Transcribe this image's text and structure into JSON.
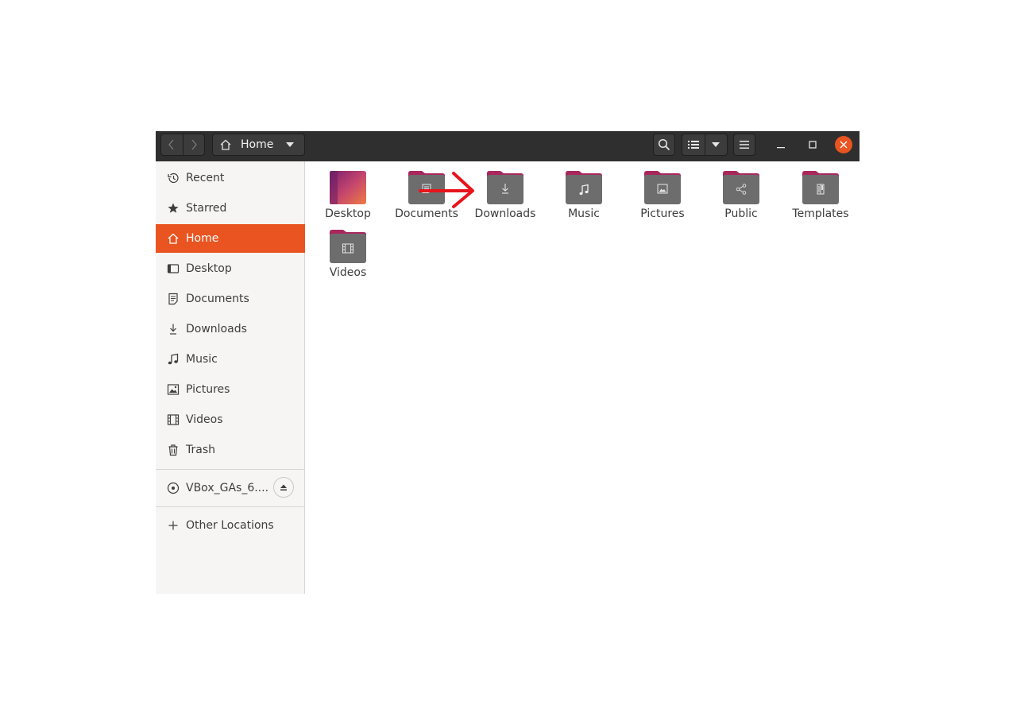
{
  "window": {
    "path": {
      "label": "Home"
    },
    "headerbar": {
      "back_icon": "chevron-left-icon",
      "forward_icon": "chevron-right-icon",
      "search_icon": "search-icon",
      "view_icon": "list-view-icon",
      "menu_icon": "hamburger-menu-icon"
    }
  },
  "sidebar": {
    "items": [
      {
        "label": "Recent",
        "icon": "recent-icon"
      },
      {
        "label": "Starred",
        "icon": "star-icon"
      },
      {
        "label": "Home",
        "icon": "home-icon",
        "active": true
      },
      {
        "label": "Desktop",
        "icon": "desktop-icon"
      },
      {
        "label": "Documents",
        "icon": "documents-icon"
      },
      {
        "label": "Downloads",
        "icon": "download-icon"
      },
      {
        "label": "Music",
        "icon": "music-icon"
      },
      {
        "label": "Pictures",
        "icon": "pictures-icon"
      },
      {
        "label": "Videos",
        "icon": "videos-icon"
      },
      {
        "label": "Trash",
        "icon": "trash-icon"
      }
    ],
    "device": {
      "label": "VBox_GAs_6....",
      "icon": "disc-icon",
      "eject_icon": "eject-icon"
    },
    "other_locations": {
      "label": "Other Locations",
      "icon": "plus-icon"
    }
  },
  "files": [
    {
      "name": "Desktop",
      "icon": "desktop-folder-icon"
    },
    {
      "name": "Documents",
      "icon": "documents-folder-icon"
    },
    {
      "name": "Downloads",
      "icon": "downloads-folder-icon"
    },
    {
      "name": "Music",
      "icon": "music-folder-icon"
    },
    {
      "name": "Pictures",
      "icon": "pictures-folder-icon"
    },
    {
      "name": "Public",
      "icon": "public-folder-icon"
    },
    {
      "name": "Templates",
      "icon": "templates-folder-icon"
    },
    {
      "name": "Videos",
      "icon": "videos-folder-icon"
    }
  ],
  "colors": {
    "accent": "#e95420",
    "headerbar": "#2f2f2f",
    "folder_body": "#6d6d6d",
    "folder_tab": "#a9275c",
    "annotation_arrow": "#e8141b"
  }
}
